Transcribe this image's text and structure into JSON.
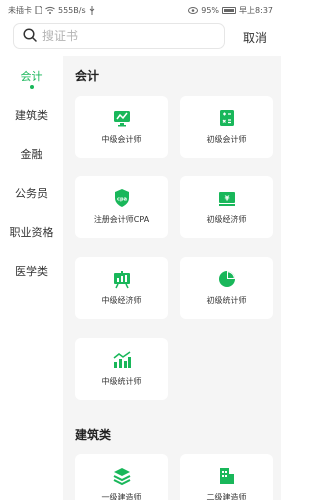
{
  "status_bar": {
    "left_text": "未插卡",
    "speed": "555B/s",
    "battery": "95%",
    "time": "早上8:37"
  },
  "search": {
    "placeholder": "搜证书",
    "cancel_label": "取消"
  },
  "sidebar": {
    "items": [
      {
        "label": "会计",
        "active": true
      },
      {
        "label": "建筑类"
      },
      {
        "label": "金融"
      },
      {
        "label": "公务员"
      },
      {
        "label": "职业资格"
      },
      {
        "label": "医学类"
      }
    ]
  },
  "sections": [
    {
      "title": "会计",
      "cards": [
        {
          "label": "中级会计师",
          "icon": "monitor-chart-icon"
        },
        {
          "label": "初级会计师",
          "icon": "calculator-icon"
        },
        {
          "label": "注册会计师CPA",
          "icon": "cpa-shield-icon"
        },
        {
          "label": "初级经济师",
          "icon": "cash-register-icon"
        },
        {
          "label": "中级经济师",
          "icon": "bar-chart-board-icon"
        },
        {
          "label": "初级统计师",
          "icon": "pie-chart-icon"
        },
        {
          "label": "中级统计师",
          "icon": "trend-bars-icon"
        }
      ]
    },
    {
      "title": "建筑类",
      "cards": [
        {
          "label": "一级建造师",
          "icon": "layers-icon"
        },
        {
          "label": "二级建造师",
          "icon": "building-icon"
        }
      ]
    }
  ],
  "colors": {
    "accent": "#19b75a",
    "background": "#f5f5f5"
  }
}
